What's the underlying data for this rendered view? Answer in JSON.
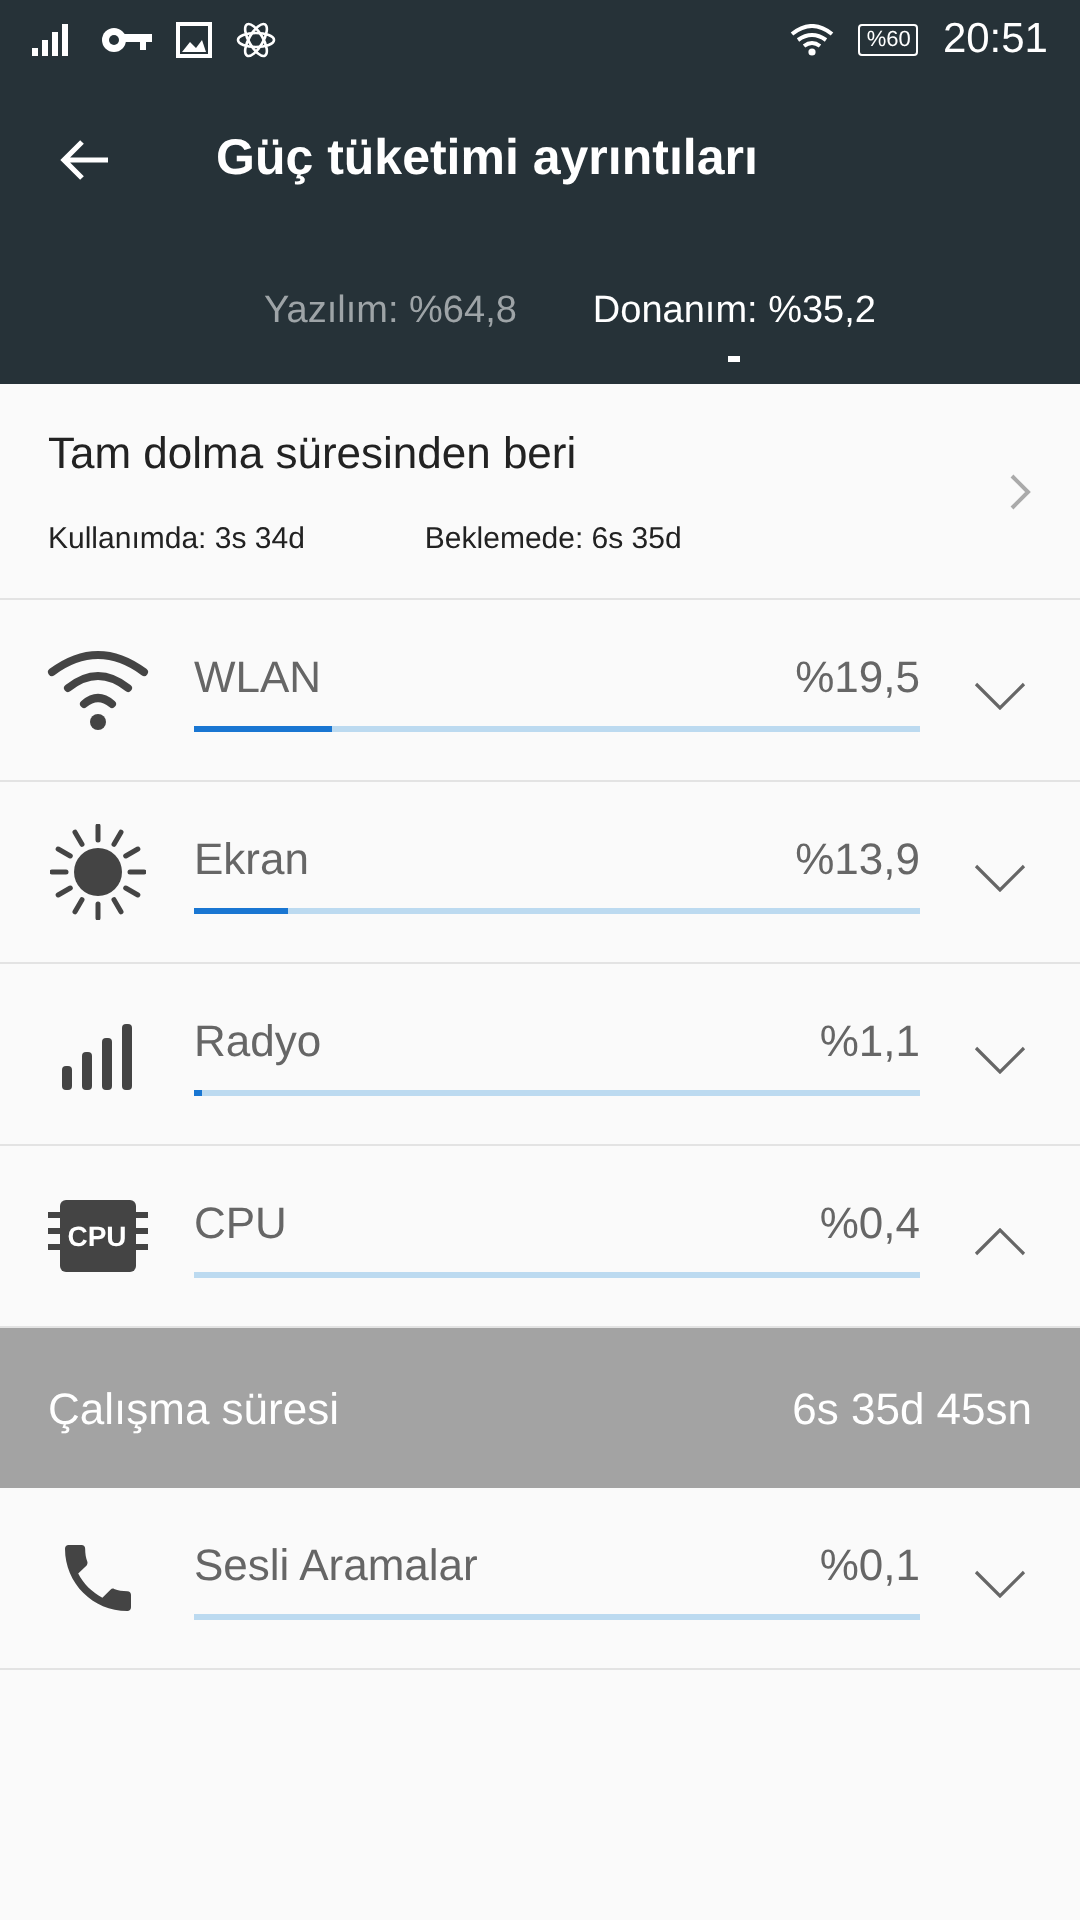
{
  "status_bar": {
    "battery": "%60",
    "time": "20:51"
  },
  "app_bar": {
    "title": "Güç tüketimi ayrıntıları"
  },
  "tabs": [
    {
      "label": "Yazılım: %64,8",
      "selected": false
    },
    {
      "label": "Donanım: %35,2",
      "selected": true
    }
  ],
  "summary": {
    "title": "Tam dolma süresinden beri",
    "in_use": "Kullanımda: 3s 34d",
    "standby": "Beklemede: 6s 35d"
  },
  "items": [
    {
      "kind": "wifi",
      "name": "WLAN",
      "percent": "%19,5",
      "level": 0.19,
      "expanded": false
    },
    {
      "kind": "sun",
      "name": "Ekran",
      "percent": "%13,9",
      "level": 0.13,
      "expanded": false
    },
    {
      "kind": "signal",
      "name": "Radyo",
      "percent": "%1,1",
      "level": 0.01,
      "expanded": false
    },
    {
      "kind": "cpu",
      "icon_text": "CPU",
      "name": "CPU",
      "percent": "%0,4",
      "expanded": true,
      "detail": {
        "label": "Çalışma süresi",
        "value": "6s 35d 45sn"
      }
    },
    {
      "kind": "phone",
      "name": "Sesli Aramalar",
      "percent": "%0,1",
      "expanded": false
    }
  ]
}
